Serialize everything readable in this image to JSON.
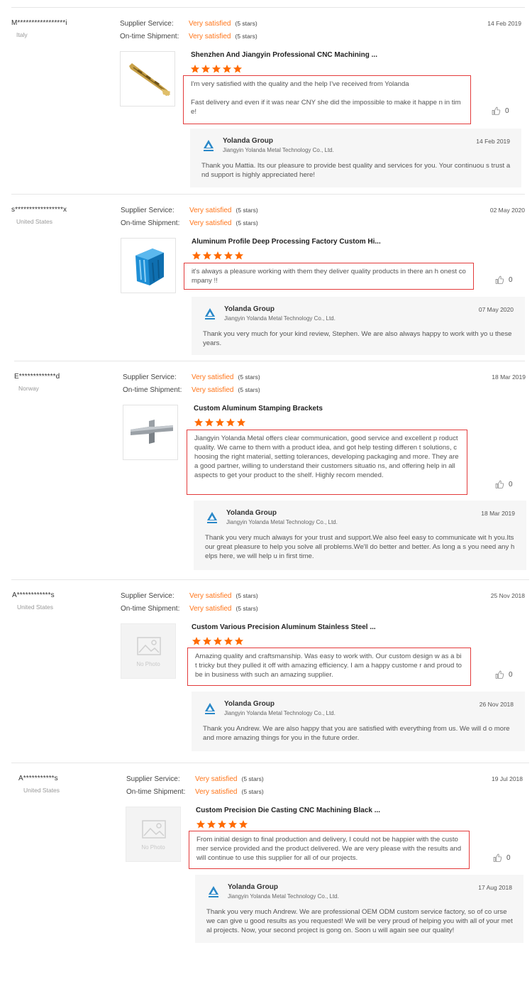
{
  "colors": {
    "accent": "#ff7519",
    "highlight_border": "#e33b3b",
    "star": "#ff6a00"
  },
  "labels": {
    "supplier_service": "Supplier Service:",
    "ontime_shipment": "On-time Shipment:",
    "no_photo": "No Photo"
  },
  "reviews": [
    {
      "user": "M*****************i",
      "country": "Italy",
      "supplier_service": "Very satisfied",
      "supplier_service_stars": "(5 stars)",
      "ontime_shipment": "Very satisfied",
      "ontime_shipment_stars": "(5 stars)",
      "date": "14 Feb 2019",
      "product": "Shenzhen And Jiangyin Professional CNC Machining ...",
      "rating": 5,
      "comment_p1": "I'm very satisfied with the quality and the help I've received from Yolanda",
      "comment_p2": "Fast delivery and even if it was near CNY she did the impossible to make it happe n in time!",
      "likes": "0",
      "image": "brass-part",
      "reply": {
        "name": "Yolanda Group",
        "company": "Jiangyin Yolanda Metal Technology Co., Ltd.",
        "date": "14 Feb 2019",
        "text": "Thank you Mattia. Its our pleasure to provide best quality and services for you. Your continuou s trust and support is highly appreciated here!"
      }
    },
    {
      "user": "s*****************x",
      "country": "United States",
      "supplier_service": "Very satisfied",
      "supplier_service_stars": "(5 stars)",
      "ontime_shipment": "Very satisfied",
      "ontime_shipment_stars": "(5 stars)",
      "date": "02 May 2020",
      "product": "Aluminum Profile Deep Processing Factory Custom Hi...",
      "rating": 5,
      "comment_p1": "it's always a pleasure working with them they deliver quality products in there an h onest company !!",
      "comment_p2": "",
      "likes": "0",
      "image": "blue-aluminum",
      "reply": {
        "name": "Yolanda Group",
        "company": "Jiangyin Yolanda Metal Technology Co., Ltd.",
        "date": "07 May 2020",
        "text": "Thank you very much for your kind review, Stephen. We are also always happy to work with yo u these years."
      }
    },
    {
      "user": "E*************d",
      "country": "Norway",
      "supplier_service": "Very satisfied",
      "supplier_service_stars": "(5 stars)",
      "ontime_shipment": "Very satisfied",
      "ontime_shipment_stars": "(5 stars)",
      "date": "18 Mar 2019",
      "product": "Custom Aluminum Stamping Brackets",
      "rating": 5,
      "comment_p1": "Jiangyin Yolanda Metal offers clear communication, good service and excellent p roduct quality. We came to them with a product idea, and got help testing differen t solutions, choosing the right material, setting tolerances, developing packaging and more. They are a good partner, willing to understand their customers situatio ns, and offering help in all aspects to get your product to the shelf. Highly recom mended.",
      "comment_p2": "",
      "likes": "0",
      "image": "bracket",
      "reply": {
        "name": "Yolanda Group",
        "company": "Jiangyin Yolanda Metal Technology Co., Ltd.",
        "date": "18 Mar 2019",
        "text": "Thank you very much always for your trust and support.We also feel easy to communicate wit h you.Its our great pleasure to help you solve all problems.We'll do better and better. As long a s you need any helps here, we will help u in first time."
      }
    },
    {
      "user": "A************s",
      "country": "United States",
      "supplier_service": "Very satisfied",
      "supplier_service_stars": "(5 stars)",
      "ontime_shipment": "Very satisfied",
      "ontime_shipment_stars": "(5 stars)",
      "date": "25 Nov 2018",
      "product": "Custom Various Precision Aluminum Stainless Steel ...",
      "rating": 5,
      "comment_p1": "Amazing quality and craftsmanship. Was easy to work with. Our custom design w as a bit tricky but they pulled it off with amazing efficiency. I am a happy custome r and proud to be in business with such an amazing supplier.",
      "comment_p2": "",
      "likes": "0",
      "image": "no-photo",
      "reply": {
        "name": "Yolanda Group",
        "company": "Jiangyin Yolanda Metal Technology Co., Ltd.",
        "date": "26 Nov 2018",
        "text": "Thank you Andrew. We are also happy that you are satisfied with everything from us. We will d o more and more amazing things for you in the future order."
      }
    },
    {
      "user": "A***********s",
      "country": "United States",
      "supplier_service": "Very satisfied",
      "supplier_service_stars": "(5 stars)",
      "ontime_shipment": "Very satisfied",
      "ontime_shipment_stars": "(5 stars)",
      "date": "19 Jul 2018",
      "product": "Custom Precision Die Casting CNC Machining Black ...",
      "rating": 5,
      "comment_p1": "From initial design to final production and delivery, I could not be happier with the customer service provided and the product delivered. We are very please with the results and will continue to use this supplier for all of our projects.",
      "comment_p2": "",
      "likes": "0",
      "image": "no-photo",
      "reply": {
        "name": "Yolanda Group",
        "company": "Jiangyin Yolanda Metal Technology Co., Ltd.",
        "date": "17 Aug 2018",
        "text": "Thank you very much Andrew. We are professional OEM ODM custom service factory, so of co urse we can give u good results as you requested! We will be very proud of helping you with all of your metal projects. Now, your second project is gong on. Soon u will again see our quality!"
      }
    }
  ]
}
